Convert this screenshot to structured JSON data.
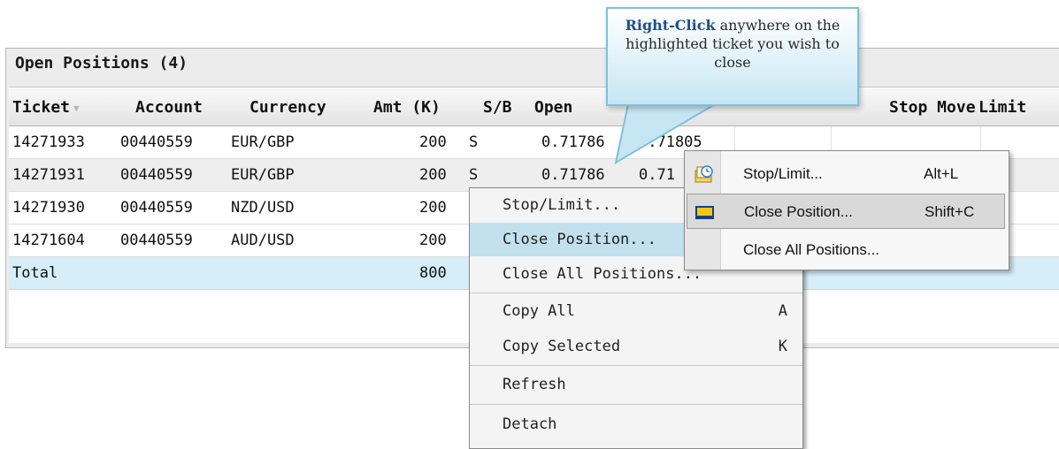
{
  "panel": {
    "title": "Open Positions (4)"
  },
  "columns": [
    "Ticket",
    "Account",
    "Currency",
    "Amt (K)",
    "S/B",
    "Open",
    "Stop Move",
    "Limit"
  ],
  "sort_icon": "sort-down-icon",
  "rows": [
    {
      "ticket": "14271933",
      "account": "00440559",
      "currency": "EUR/GBP",
      "amt": "200",
      "sb": "S",
      "open": "0.71786",
      "close": "0.71805"
    },
    {
      "ticket": "14271931",
      "account": "00440559",
      "currency": "EUR/GBP",
      "amt": "200",
      "sb": "S",
      "open": "0.71786",
      "close": "0.71"
    },
    {
      "ticket": "14271930",
      "account": "00440559",
      "currency": "NZD/USD",
      "amt": "200"
    },
    {
      "ticket": "14271604",
      "account": "00440559",
      "currency": "AUD/USD",
      "amt": "200"
    }
  ],
  "total": {
    "label": "Total",
    "amt": "800"
  },
  "callout": {
    "bold": "Right-Click",
    "text": " anywhere on the highlighted ticket you wish to close"
  },
  "context_menu": {
    "items": [
      {
        "label": "Stop/Limit...",
        "key": ""
      },
      {
        "label": "Close Position...",
        "key": ""
      },
      {
        "label": "Close All Positions...",
        "key": ""
      },
      {
        "label": "Copy All",
        "key": "A"
      },
      {
        "label": "Copy Selected",
        "key": "K"
      },
      {
        "label": "Refresh",
        "key": ""
      },
      {
        "label": "Detach",
        "key": ""
      }
    ]
  },
  "new_menu": {
    "items": [
      {
        "label": "Stop/Limit...",
        "key": "Alt+L",
        "icon": "stop-limit-icon"
      },
      {
        "label": "Close Position...",
        "key": "Shift+C",
        "icon": "close-position-icon"
      },
      {
        "label": "Close All Positions...",
        "key": "",
        "icon": ""
      }
    ]
  },
  "colors": {
    "highlight": "#c3e0ee",
    "total_row": "#d6eef8",
    "callout_border": "#7ec0dc"
  }
}
